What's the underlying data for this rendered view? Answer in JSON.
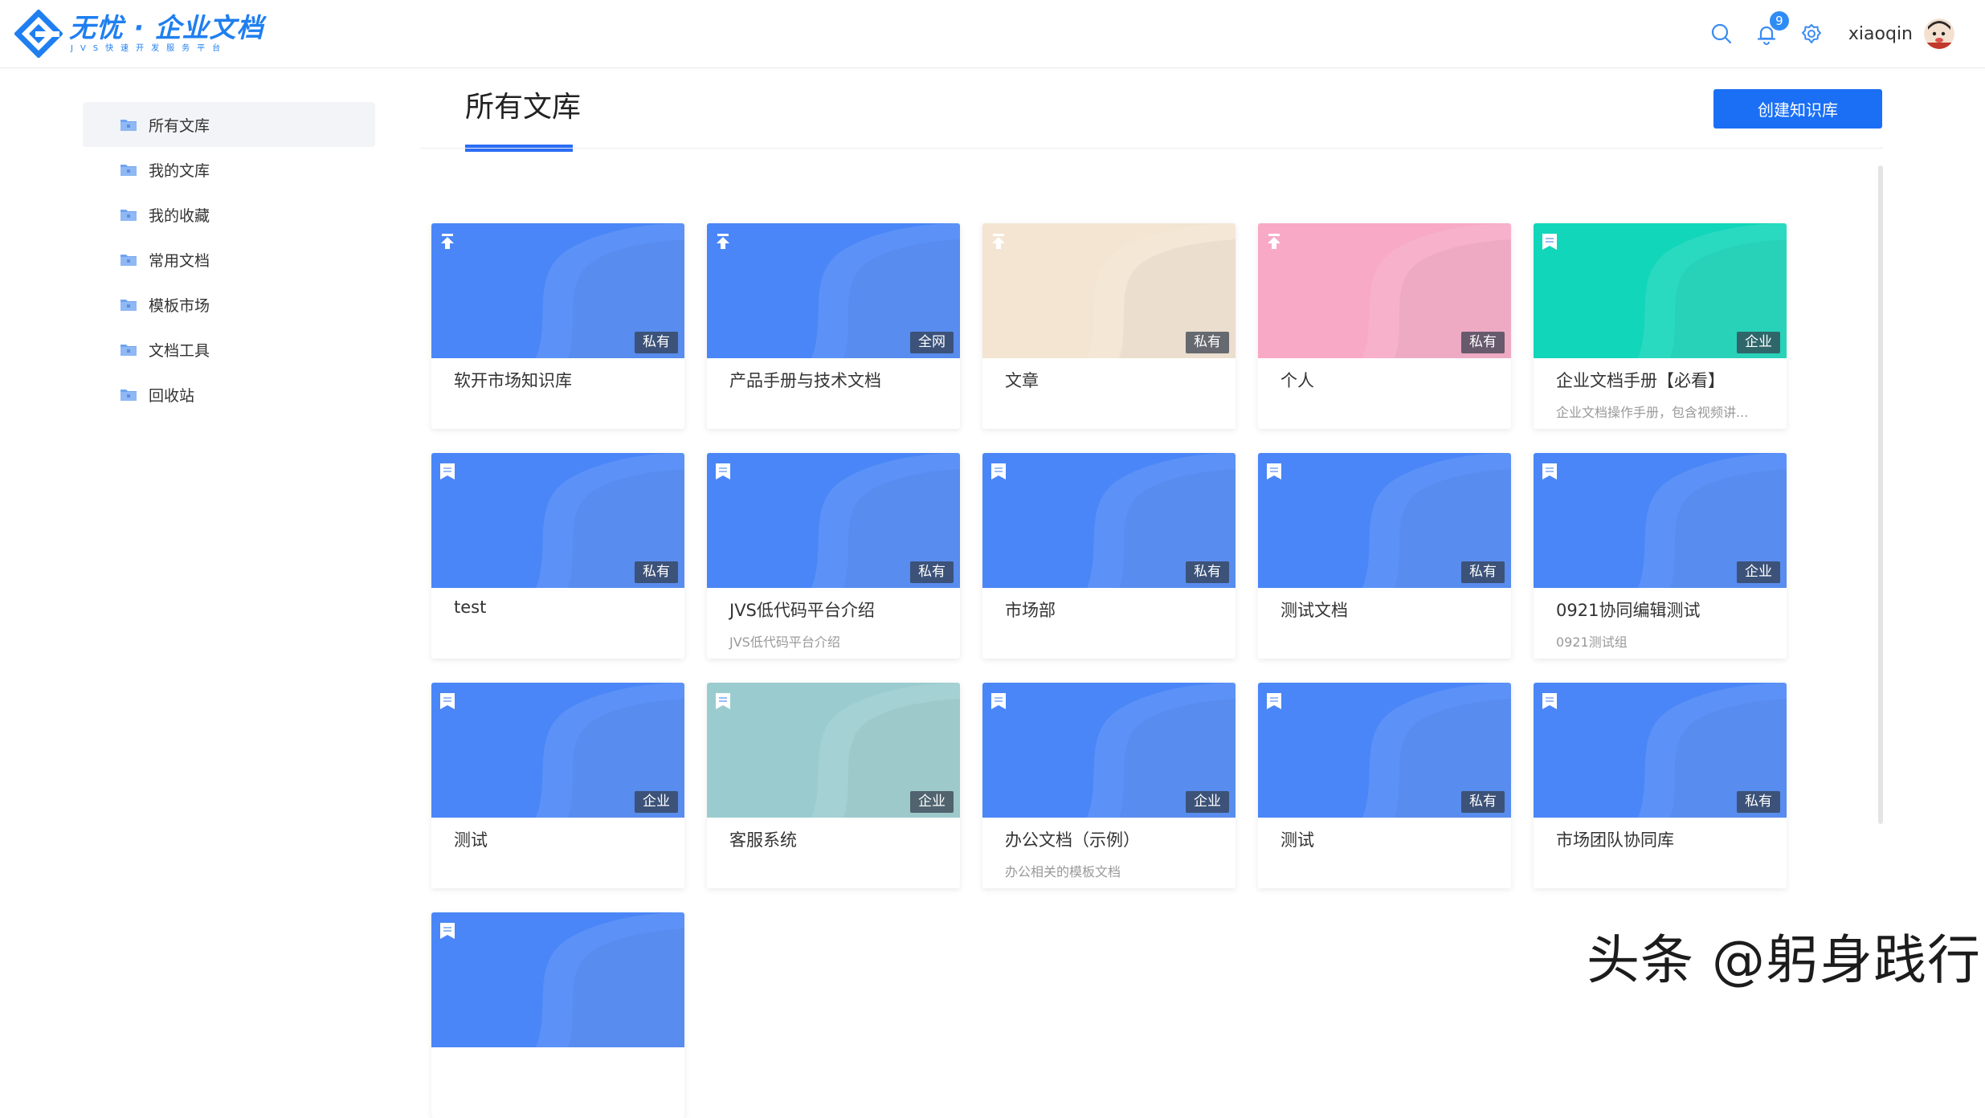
{
  "brand": {
    "title": "无忧 · 企业文档",
    "subtitle": "JVS快速开发服务平台",
    "color": "#1f7ff0"
  },
  "header": {
    "notification_count": "9",
    "username": "xiaoqin",
    "icons": [
      "search-icon",
      "bell-icon",
      "gear-icon"
    ]
  },
  "sidebar": {
    "items": [
      {
        "label": "所有文库",
        "active": true
      },
      {
        "label": "我的文库"
      },
      {
        "label": "我的收藏"
      },
      {
        "label": "常用文档"
      },
      {
        "label": "模板市场"
      },
      {
        "label": "文档工具"
      },
      {
        "label": "回收站"
      }
    ]
  },
  "main": {
    "title": "所有文库",
    "create_button": "创建知识库",
    "accent": "#1a6ff5"
  },
  "libraries": [
    {
      "name": "软开市场知识库",
      "desc": "",
      "tag": "私有",
      "color": "#4a86f7",
      "icon": "pin-icon"
    },
    {
      "name": "产品手册与技术文档",
      "desc": "",
      "tag": "全网",
      "color": "#4a86f7",
      "icon": "pin-icon"
    },
    {
      "name": "文章",
      "desc": "",
      "tag": "私有",
      "color": "#f3e5d2",
      "icon": "pin-icon"
    },
    {
      "name": "个人",
      "desc": "",
      "tag": "私有",
      "color": "#f8a9c6",
      "icon": "pin-icon"
    },
    {
      "name": "企业文档手册【必看】",
      "desc": "企业文档操作手册，包含视频讲...",
      "tag": "企业",
      "color": "#12d6b9",
      "icon": "bookmark-icon"
    },
    {
      "name": "test",
      "desc": "",
      "tag": "私有",
      "color": "#4a86f7",
      "icon": "bookmark-icon"
    },
    {
      "name": "JVS低代码平台介绍",
      "desc": "JVS低代码平台介绍",
      "tag": "私有",
      "color": "#4a86f7",
      "icon": "bookmark-icon"
    },
    {
      "name": "市场部",
      "desc": "",
      "tag": "私有",
      "color": "#4a86f7",
      "icon": "bookmark-icon"
    },
    {
      "name": "测试文档",
      "desc": "",
      "tag": "私有",
      "color": "#4a86f7",
      "icon": "bookmark-icon"
    },
    {
      "name": "0921协同编辑测试",
      "desc": "0921测试组",
      "tag": "企业",
      "color": "#4a86f7",
      "icon": "bookmark-icon"
    },
    {
      "name": "测试",
      "desc": "",
      "tag": "企业",
      "color": "#4a86f7",
      "icon": "bookmark-icon"
    },
    {
      "name": "客服系统",
      "desc": "",
      "tag": "企业",
      "color": "#9acccf",
      "icon": "bookmark-icon"
    },
    {
      "name": "办公文档（示例）",
      "desc": "办公相关的模板文档",
      "tag": "企业",
      "color": "#4a86f7",
      "icon": "bookmark-icon"
    },
    {
      "name": "测试",
      "desc": "",
      "tag": "私有",
      "color": "#4a86f7",
      "icon": "bookmark-icon"
    },
    {
      "name": "市场团队协同库",
      "desc": "",
      "tag": "私有",
      "color": "#4a86f7",
      "icon": "bookmark-icon"
    },
    {
      "name": "",
      "desc": "",
      "tag": "",
      "color": "#4a86f7",
      "icon": "bookmark-icon"
    }
  ],
  "watermark": "头条 @躬身践行"
}
